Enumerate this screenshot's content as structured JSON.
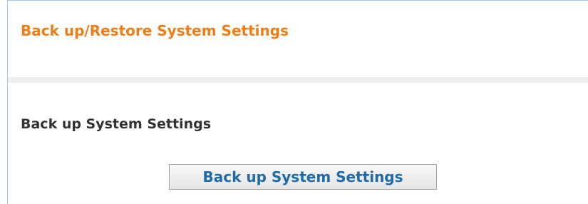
{
  "page": {
    "title": "Back up/Restore System Settings"
  },
  "backup_section": {
    "title": "Back up System Settings",
    "button_label": "Back up System Settings"
  },
  "colors": {
    "title_accent": "#f07d14",
    "button_text": "#1e6ba8",
    "frame_border": "#9ec5e6",
    "divider": "#eeeeee"
  }
}
